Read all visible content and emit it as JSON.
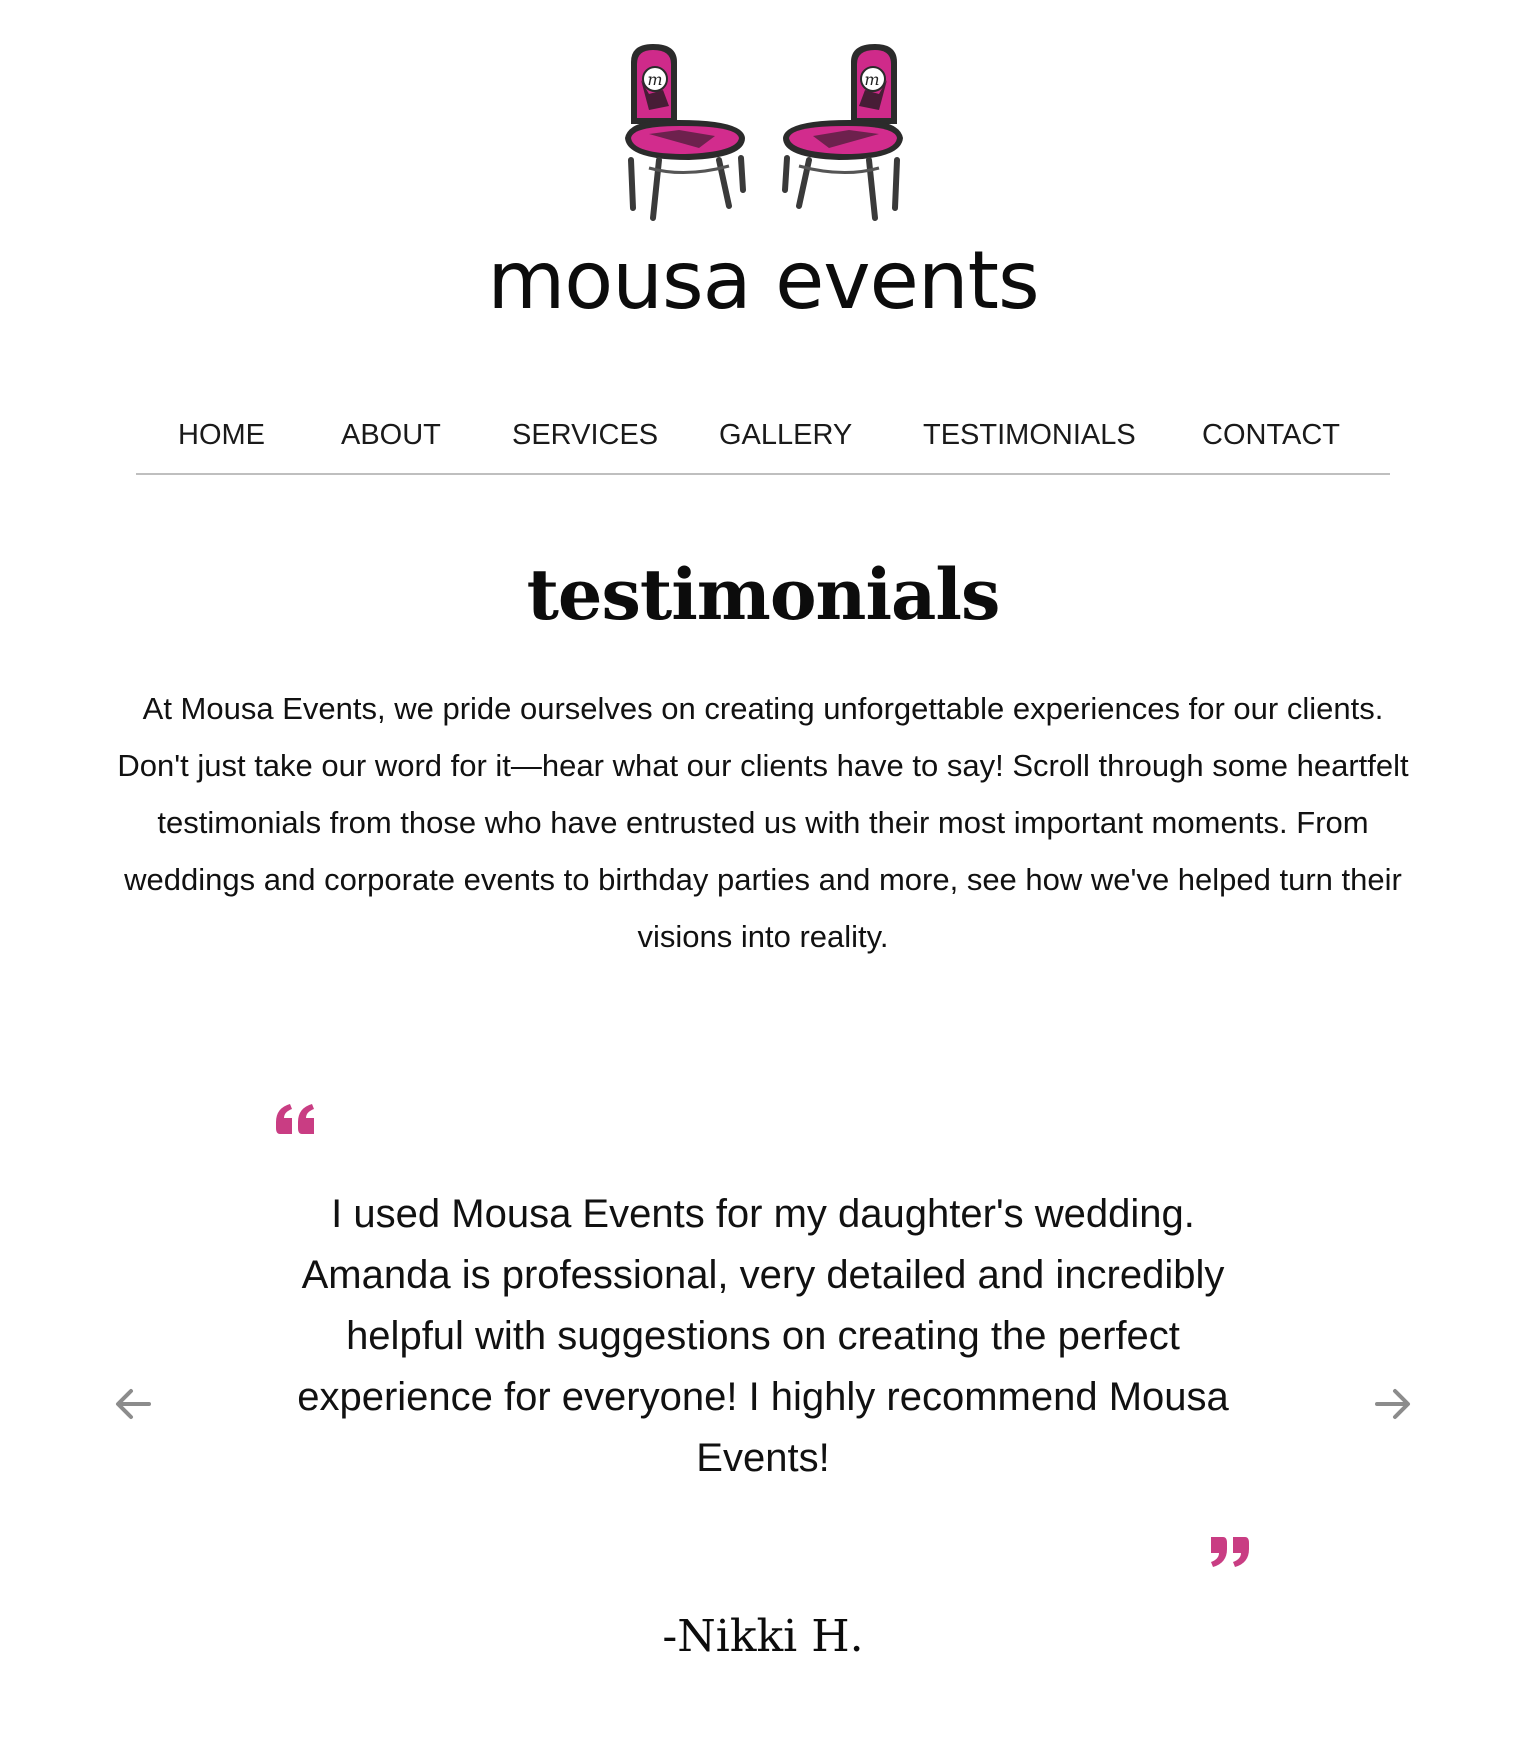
{
  "site": {
    "brand": "mousa events",
    "logo_icon": "two-pink-chairs-logo-icon",
    "accent_color": "#c93d83"
  },
  "nav": {
    "items": [
      {
        "label": "HOME"
      },
      {
        "label": "ABOUT"
      },
      {
        "label": "SERVICES"
      },
      {
        "label": "GALLERY"
      },
      {
        "label": "TESTIMONIALS"
      },
      {
        "label": "CONTACT"
      }
    ]
  },
  "page": {
    "title": "testimonials",
    "intro": "At Mousa Events, we pride ourselves on creating unforgettable experiences for our clients. Don't just take our word for it—hear what our clients have to say! Scroll through some heartfelt testimonials from those who have entrusted us with their most important moments. From weddings and corporate events to birthday parties and more, see how we've helped turn their visions into reality."
  },
  "testimonial": {
    "text": "I used Mousa Events for my daughter's wedding. Amanda is professional, very detailed and incredibly helpful with suggestions on creating the perfect experience for everyone! I highly recommend Mousa Events!",
    "author": "-Nikki H.",
    "open_quote_icon": "open-quote-icon",
    "close_quote_icon": "close-quote-icon",
    "prev_icon": "arrow-left-icon",
    "next_icon": "arrow-right-icon"
  }
}
